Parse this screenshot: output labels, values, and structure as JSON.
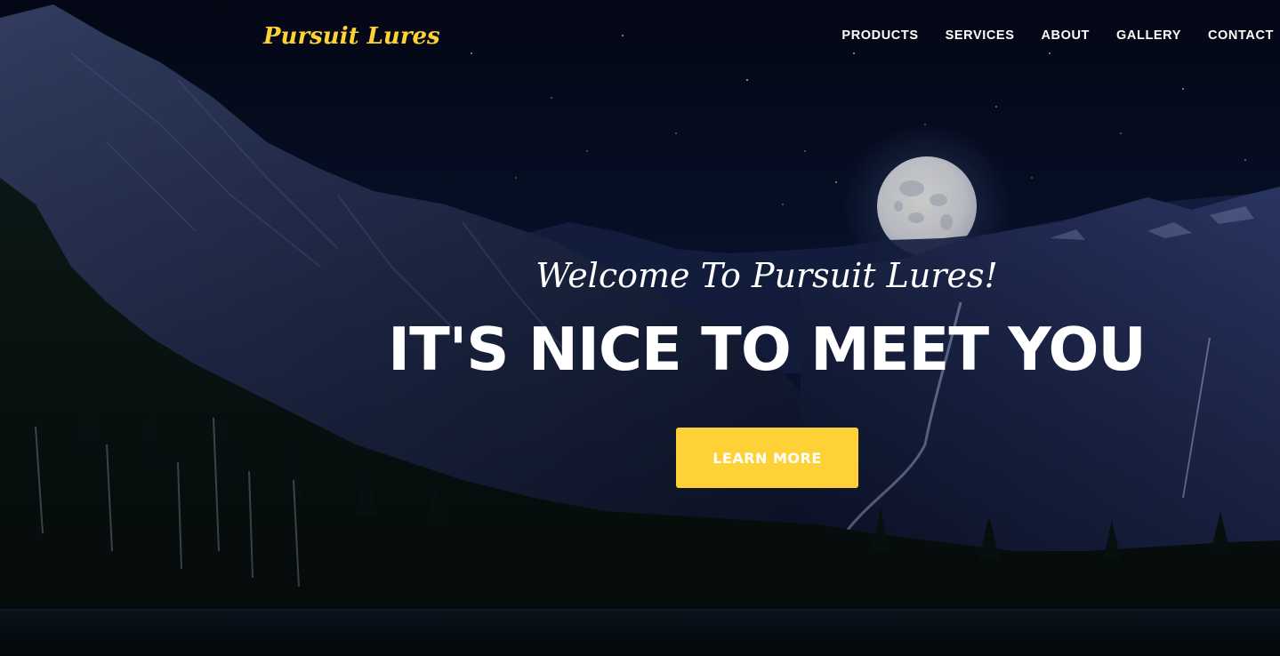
{
  "brand": {
    "name": "Pursuit Lures",
    "color": "#fed136"
  },
  "nav": {
    "items": [
      {
        "label": "PRODUCTS"
      },
      {
        "label": "SERVICES"
      },
      {
        "label": "ABOUT"
      },
      {
        "label": "GALLERY"
      },
      {
        "label": "CONTACT"
      }
    ]
  },
  "hero": {
    "lead_in": "Welcome To Pursuit Lures!",
    "heading": "IT'S NICE TO MEET YOU",
    "button_label": "LEARN MORE",
    "background": "night-mountain-lake-full-moon-scene"
  },
  "colors": {
    "accent": "#fed136",
    "text": "#ffffff",
    "sky": "#050a1c"
  }
}
